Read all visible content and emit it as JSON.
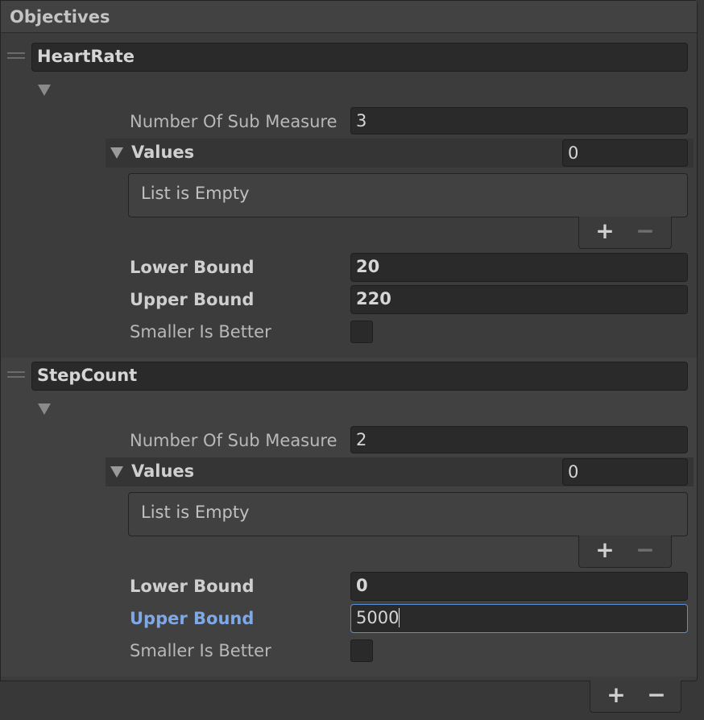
{
  "panel": {
    "title": "Objectives"
  },
  "elements": [
    {
      "name": "HeartRate",
      "sub_measure_label": "Number Of Sub Measure",
      "sub_measure_value": "3",
      "values_label": "Values",
      "values_count": "0",
      "list_empty_text": "List is Empty",
      "lower_bound_label": "Lower Bound",
      "lower_bound_value": "20",
      "upper_bound_label": "Upper Bound",
      "upper_bound_value": "220",
      "smaller_is_better_label": "Smaller Is Better",
      "smaller_is_better_checked": false
    },
    {
      "name": "StepCount",
      "sub_measure_label": "Number Of Sub Measure",
      "sub_measure_value": "2",
      "values_label": "Values",
      "values_count": "0",
      "list_empty_text": "List is Empty",
      "lower_bound_label": "Lower Bound",
      "lower_bound_value": "0",
      "upper_bound_label": "Upper Bound",
      "upper_bound_value": "5000",
      "smaller_is_better_label": "Smaller Is Better",
      "smaller_is_better_checked": false
    }
  ],
  "buttons": {
    "add": "+",
    "remove": "−"
  },
  "colors": {
    "background": "#383838",
    "field_bg": "#2a2a2a",
    "focus_border": "#5a8fd6",
    "active_label": "#7fa8e6"
  },
  "icons": {
    "drag_handle": "drag-handle-icon",
    "foldout": "foldout-arrow-icon"
  }
}
